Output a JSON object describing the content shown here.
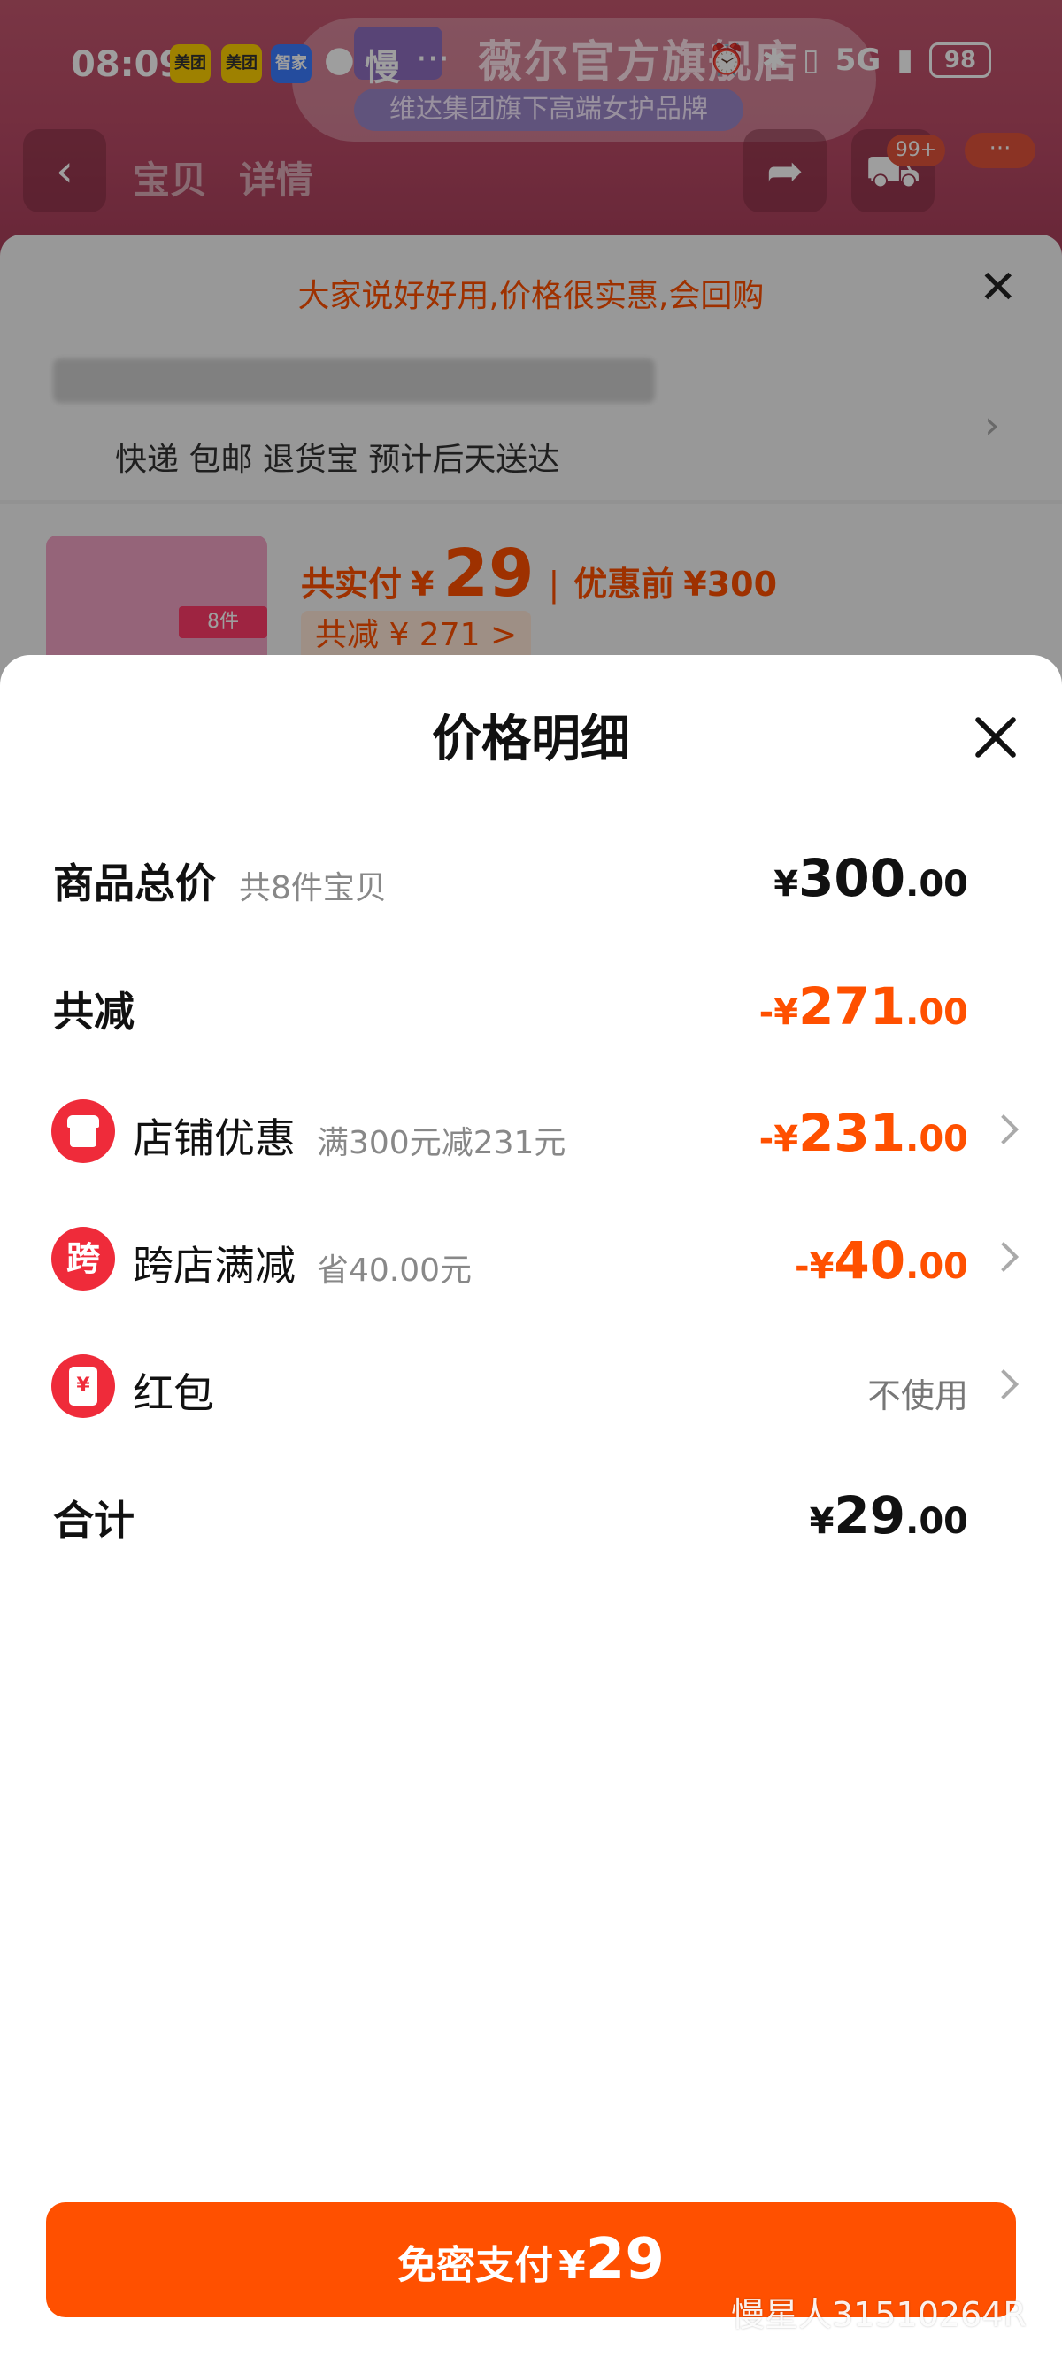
{
  "status_bar": {
    "time": "08:09",
    "apps": [
      "美团",
      "美团",
      "智家"
    ],
    "extra_glyph": "慢",
    "dots": "···",
    "network": "5G",
    "battery": "98"
  },
  "store": {
    "name": "薇尔官方旗舰店",
    "subtitle": "维达集团旗下高端女护品牌"
  },
  "nav": {
    "tab_1": "宝贝",
    "tab_2": "详情",
    "cart_badge": "99+",
    "more_glyph": "···"
  },
  "background_sheet": {
    "promo": "大家说好好用,价格很实惠,会回购",
    "shipping": "快递 包邮 退货宝 预计后天送达",
    "pay_label": "共实付",
    "pay_currency": "¥",
    "pay_amount": "29",
    "original_label": "优惠前",
    "original_price": "¥300",
    "saved": "共减 ¥ 271 >",
    "product_tag": "8件"
  },
  "price_detail": {
    "title": "价格明细",
    "rows": {
      "total": {
        "label": "商品总价",
        "sub": "共8件宝贝",
        "currency": "¥",
        "integer": "300",
        "decimal": ".00"
      },
      "discount": {
        "label": "共减",
        "currency": "-¥",
        "integer": "271",
        "decimal": ".00"
      },
      "store_coupon": {
        "label": "店铺优惠",
        "sub": "满300元减231元",
        "currency": "-¥",
        "integer": "231",
        "decimal": ".00",
        "icon": "store-icon"
      },
      "cross_store": {
        "label": "跨店满减",
        "sub": "省40.00元",
        "currency": "-¥",
        "integer": "40",
        "decimal": ".00",
        "icon_text": "跨"
      },
      "red_packet": {
        "label": "红包",
        "value": "不使用",
        "icon": "red-packet-icon"
      },
      "sum": {
        "label": "合计",
        "currency": "¥",
        "integer": "29",
        "decimal": ".00"
      }
    }
  },
  "pay_button": {
    "label": "免密支付",
    "currency": "¥",
    "amount": "29"
  },
  "watermark": "慢星人31510264R",
  "colors": {
    "accent": "#ff5000",
    "icon_red": "#ef2b3a"
  }
}
